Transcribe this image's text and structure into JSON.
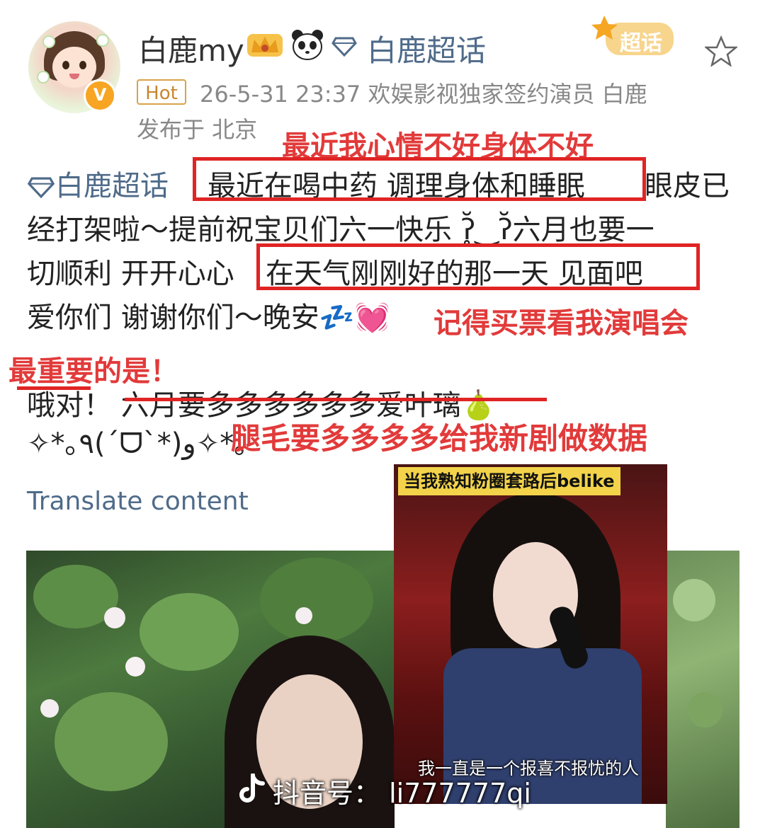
{
  "header": {
    "username": "白鹿my",
    "supertopic_label": "白鹿超话",
    "supertopic_badge": "超话",
    "hot_badge": "Hot",
    "meta": "26-5-31 23:37  欢娱影视独家签约演员 白鹿",
    "location": "发布于 北京",
    "icons": [
      "avatar",
      "verified-badge-icon",
      "crown-icon",
      "panda-icon",
      "diamond-icon",
      "star-icon"
    ]
  },
  "post": {
    "topic": "白鹿超话",
    "line1_highlight": "最近在喝中药 调理身体和睡眠",
    "line1_tail": "眼皮已",
    "line2": "经打架啦～提前祝宝贝们六一快乐 ʔ̥̆‿ʔ̆六月也要一",
    "line3_head": "切顺利 开开心心",
    "line3_highlight": "在天气刚刚好的那一天 见面吧",
    "line4": "爱你们 谢谢你们～晚安💤💓",
    "line5": "哦对！ 六月要多多多多多多爱叶璃🍐",
    "line6": "✧*｡٩(ˊᗜˋ*)و✧*｡",
    "translate": "Translate content"
  },
  "annotations": {
    "a1": "最近我心情不好身体不好",
    "a2": "记得买票看我演唱会",
    "a3": "最重要的是！",
    "a4": "腿毛要多多多多给我新剧做数据",
    "color": "#e02424"
  },
  "media": {
    "video_caption": "当我熟知粉圈套路后belike",
    "video_subtitle": "我一直是一个报喜不报忧的人",
    "watermark": "抖音号： li777777qi"
  }
}
